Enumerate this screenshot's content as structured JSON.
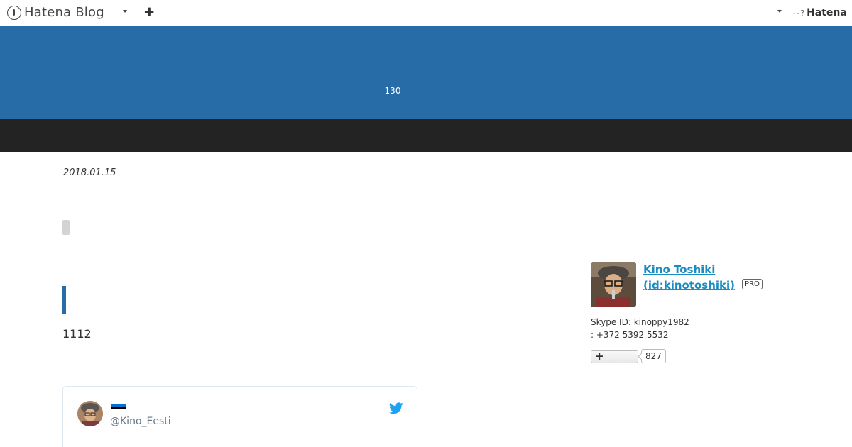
{
  "global_header": {
    "logo_text": "Hatena Blog",
    "brand_text": "Hatena",
    "brand_glyph": "~?"
  },
  "blog": {
    "title": "130"
  },
  "entry": {
    "date": "2018.01.15",
    "body_text": "1112"
  },
  "tweet": {
    "handle": "@Kino_Eesti",
    "flag_colors": [
      "#0072ce",
      "#000000",
      "#ffffff"
    ]
  },
  "profile": {
    "name_line1": "Kino Toshiki",
    "name_line2": "(id:kinotoshiki)",
    "badge": "PRO",
    "desc_line1": "Skype ID: kinoppy1982",
    "desc_line2": ": +372 5392 5532",
    "follow_plus": "+",
    "follower_count": "827"
  },
  "colors": {
    "banner": "#286ca7",
    "nav_bar": "#232323",
    "link": "#1b8bc0",
    "twitter": "#1da1f2"
  }
}
